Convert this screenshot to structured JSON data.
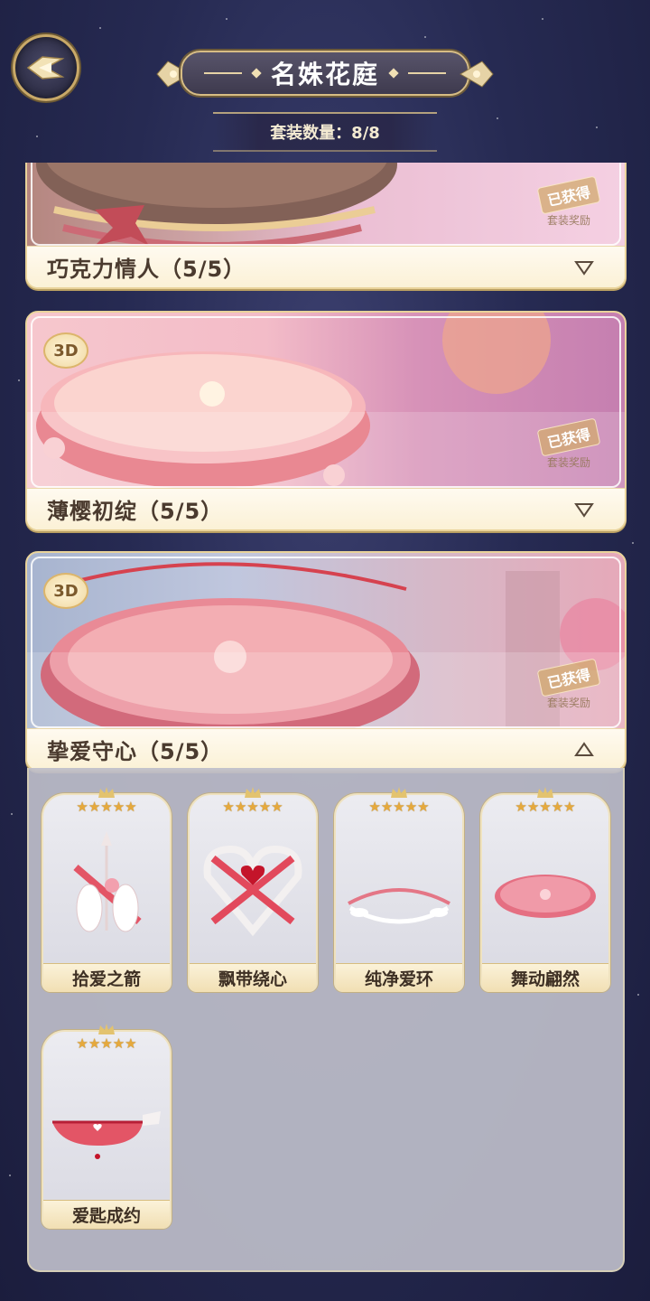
{
  "header": {
    "title": "名姝花庭",
    "count_label": "套装数量：8/8"
  },
  "obtained": {
    "stamp": "已获得",
    "sub": "套装奖励"
  },
  "badge_3d": "3D",
  "suits": [
    {
      "name": "巧克力情人（5/5）",
      "has_3d": false,
      "expanded": false
    },
    {
      "name": "薄樱初绽（5/5）",
      "has_3d": true,
      "expanded": false
    },
    {
      "name": "挚爱守心（5/5）",
      "has_3d": true,
      "expanded": true
    }
  ],
  "items": [
    {
      "name": "拾爱之箭",
      "stars": "★★★★★"
    },
    {
      "name": "飘带绕心",
      "stars": "★★★★★"
    },
    {
      "name": "纯净爱环",
      "stars": "★★★★★"
    },
    {
      "name": "舞动翩然",
      "stars": "★★★★★"
    },
    {
      "name": "爱匙成约",
      "stars": "★★★★★"
    }
  ]
}
